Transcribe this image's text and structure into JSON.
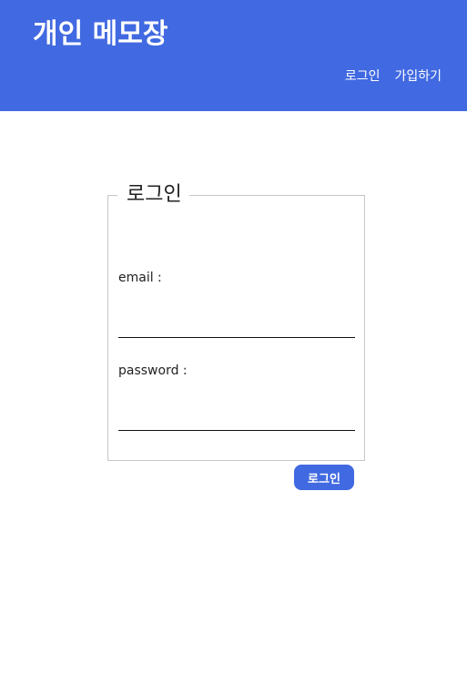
{
  "header": {
    "brand": "개인 메모장",
    "nav": {
      "login": "로그인",
      "signup": "가입하기"
    }
  },
  "login_form": {
    "legend": "로그인",
    "email_label": "email :",
    "email_value": "",
    "password_label": "password :",
    "password_value": "",
    "submit_label": "로그인"
  },
  "colors": {
    "primary": "#4169e1",
    "border": "#c7c7c7",
    "text": "#222222"
  }
}
